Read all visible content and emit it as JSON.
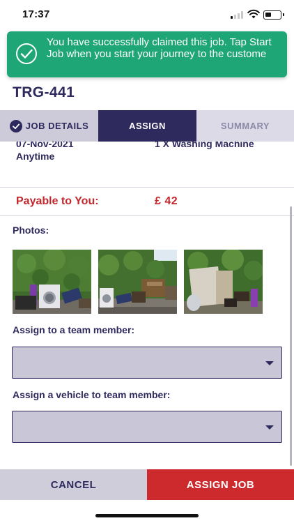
{
  "status_bar": {
    "time": "17:37"
  },
  "toast": {
    "message": "You have successfully claimed this job. Tap Start Job when you start your journey to the custome",
    "icon": "check-circle-icon",
    "color": "#1fa677"
  },
  "job": {
    "reference": "TRG-441",
    "date": "07-Nov-2021",
    "time_window": "Anytime",
    "item": "1 X Washing Machine"
  },
  "tabs": [
    {
      "label": "JOB DETAILS",
      "state": "completed"
    },
    {
      "label": "ASSIGN",
      "state": "active"
    },
    {
      "label": "SUMMARY",
      "state": "inactive"
    }
  ],
  "payable": {
    "label": "Payable to You:",
    "value": "£ 42"
  },
  "photos": {
    "label": "Photos:",
    "items": [
      "photo-washing-machine-waste",
      "photo-garden-waste-pile",
      "photo-boards-and-dish"
    ]
  },
  "assign_member": {
    "label": "Assign to a team member:",
    "value": ""
  },
  "assign_vehicle": {
    "label": "Assign a vehicle to team member:",
    "value": ""
  },
  "buttons": {
    "cancel": "CANCEL",
    "assign": "ASSIGN JOB"
  },
  "colors": {
    "primary": "#2e2a5e",
    "accent_red": "#cd2a2e",
    "success": "#1fa677"
  }
}
